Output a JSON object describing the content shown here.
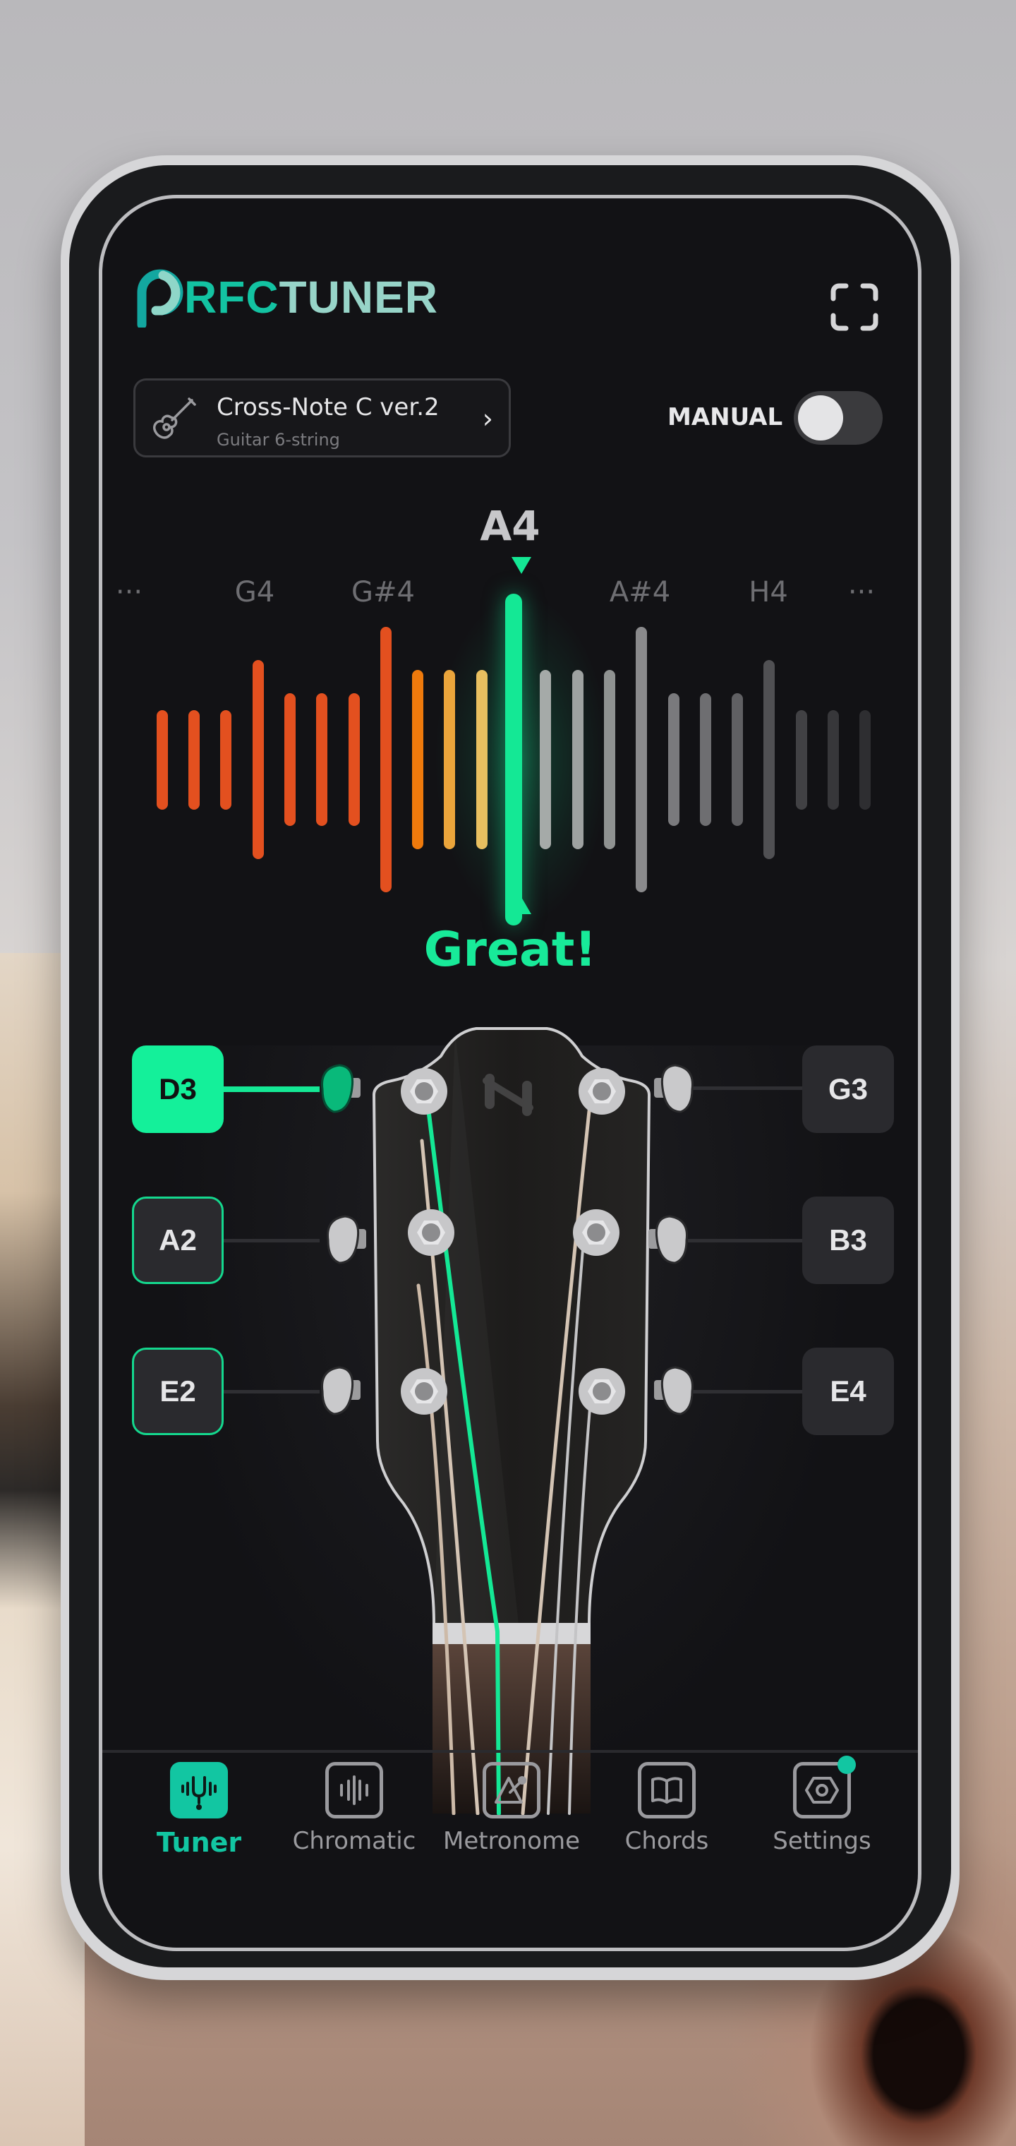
{
  "app": {
    "logo_prefix": "RFC",
    "logo_suffix": "TUNER",
    "fullscreen_icon": "fullscreen-icon"
  },
  "preset": {
    "title": "Cross-Note C ver.2",
    "subtitle": "Guitar 6-string",
    "icon": "guitar-icon",
    "chevron": "›"
  },
  "manual": {
    "label": "MANUAL",
    "enabled": false
  },
  "tuner": {
    "current_note": "A4",
    "neighbors": [
      "···",
      "G4",
      "G#4",
      "A#4",
      "H4",
      "···"
    ],
    "status": "Great!",
    "accent_color": "#14e895",
    "meter": {
      "levels": [
        0.3,
        0.3,
        0.3,
        0.6,
        0.4,
        0.4,
        0.4,
        0.8,
        0.54,
        0.54,
        0.54,
        1.0,
        0.54,
        0.54,
        0.54,
        0.8,
        0.4,
        0.4,
        0.4,
        0.6,
        0.3,
        0.3,
        0.3
      ],
      "colors": [
        "#e3501f",
        "#e3501f",
        "#e3501f",
        "#e3501f",
        "#e3501f",
        "#e3501f",
        "#e3501f",
        "#e3501f",
        "#ef7a0c",
        "#eba53b",
        "#e9c060",
        "#14e895",
        "#a5aaa8",
        "#9ea2a1",
        "#8f9291",
        "#8a8a8c",
        "#7a7a7d",
        "#6e6e71",
        "#606063",
        "#505053",
        "#414144",
        "#37373a",
        "#2e2e31"
      ]
    }
  },
  "strings": {
    "left": [
      {
        "note": "D3",
        "state": "active"
      },
      {
        "note": "A2",
        "state": "tuned"
      },
      {
        "note": "E2",
        "state": "tuned"
      }
    ],
    "right": [
      {
        "note": "G3",
        "state": "idle"
      },
      {
        "note": "B3",
        "state": "idle"
      },
      {
        "note": "E4",
        "state": "idle"
      }
    ],
    "active_string_color": "#14e895"
  },
  "nav": {
    "items": [
      {
        "label": "Tuner",
        "icon": "tuning-fork-icon",
        "active": true
      },
      {
        "label": "Chromatic",
        "icon": "waveform-icon",
        "active": false
      },
      {
        "label": "Metronome",
        "icon": "metronome-icon",
        "active": false
      },
      {
        "label": "Chords",
        "icon": "book-icon",
        "active": false
      },
      {
        "label": "Settings",
        "icon": "settings-icon",
        "active": false,
        "badge": true
      }
    ],
    "accent_color": "#12c6a2"
  }
}
